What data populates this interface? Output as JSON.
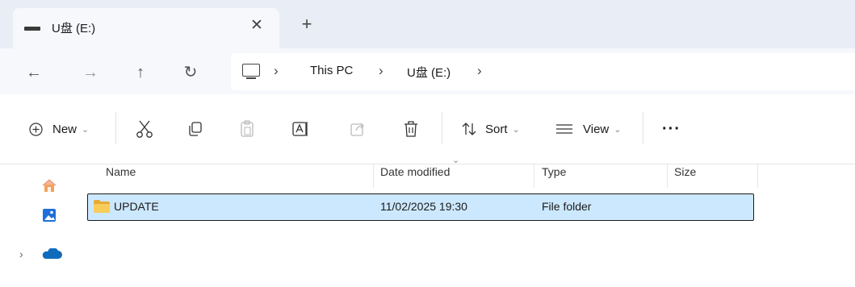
{
  "tab": {
    "title": "U盘 (E:)",
    "close_glyph": "✕",
    "new_glyph": "+"
  },
  "nav": {
    "back": "←",
    "forward": "→",
    "up": "↑",
    "refresh": "↻"
  },
  "address": {
    "separator": "›",
    "crumbs": [
      "This PC",
      "U盘 (E:)"
    ]
  },
  "toolbar": {
    "new_label": "New",
    "sort_label": "Sort",
    "view_label": "View",
    "more_label": "···",
    "chevron": "⌄"
  },
  "columns": {
    "name": "Name",
    "date_modified": "Date modified",
    "type": "Type",
    "size": "Size"
  },
  "files": [
    {
      "name": "UPDATE",
      "date_modified": "11/02/2025 19:30",
      "type": "File folder",
      "size": ""
    }
  ],
  "colors": {
    "selection": "#cce8ff",
    "tabbar": "#e9eef6",
    "folder": "#f4c74a",
    "onedrive": "#0f6cbd"
  },
  "icons": {
    "home": "home-icon",
    "gallery": "gallery-icon",
    "onedrive": "onedrive-icon"
  }
}
